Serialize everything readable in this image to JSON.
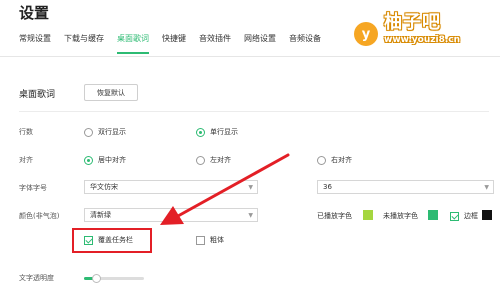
{
  "header": {
    "title": "设置",
    "tabs": [
      {
        "label": "常规设置",
        "active": false
      },
      {
        "label": "下载与缓存",
        "active": false
      },
      {
        "label": "桌面歌词",
        "active": true
      },
      {
        "label": "快捷键",
        "active": false
      },
      {
        "label": "音效插件",
        "active": false
      },
      {
        "label": "网络设置",
        "active": false
      },
      {
        "label": "音频设备",
        "active": false
      }
    ]
  },
  "watermark": {
    "logo_letter": "y",
    "name": "柚子吧",
    "url": "www.youzi8.cn"
  },
  "section": {
    "title": "桌面歌词",
    "reset_label": "恢复默认"
  },
  "rows": {
    "lines": {
      "label": "行数",
      "option_double": "双行显示",
      "option_single": "单行显示",
      "selected": "单行显示"
    },
    "align": {
      "label": "对齐",
      "option_center": "居中对齐",
      "option_left": "左对齐",
      "option_right": "右对齐",
      "selected": "居中对齐"
    },
    "font": {
      "label": "字体字号",
      "family_value": "华文仿宋",
      "size_value": "36"
    },
    "color": {
      "label": "颜色(非气泡)",
      "preset_value": "清新绿",
      "played_label": "已播放字色",
      "unplayed_label": "未播放字色",
      "border_label": "边框",
      "played_color": "#a5d63f",
      "unplayed_color": "#2dbb73",
      "border_color": "#111111"
    },
    "options": {
      "cover_taskbar_label": "覆盖任务栏",
      "cover_taskbar_checked": true,
      "bold_label": "粗体",
      "bold_checked": false,
      "border_checked": true
    },
    "opacity": {
      "label": "文字透明度",
      "value": 0.2
    }
  },
  "colors": {
    "accent": "#2dbb73",
    "highlight": "#e31f26"
  }
}
